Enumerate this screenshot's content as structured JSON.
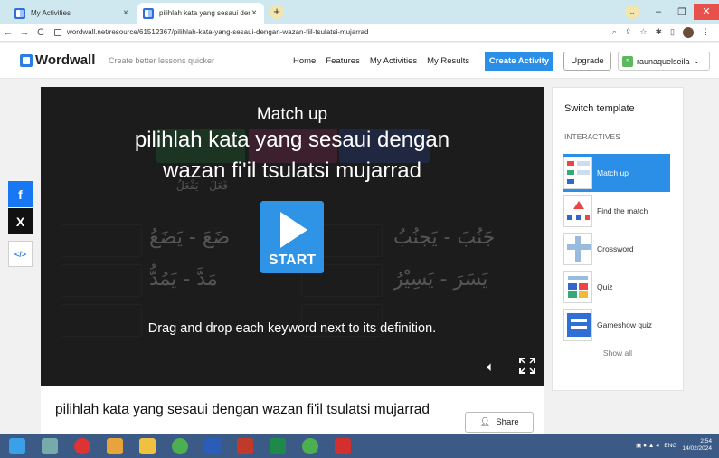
{
  "browser": {
    "tabs": [
      {
        "title": "My Activities"
      },
      {
        "title": "pilihlah kata yang sesaui dengan"
      }
    ],
    "url": "wordwall.net/resource/61512367/pilihlah-kata-yang-sesaui-dengan-wazan-fiil-tsulatsi-mujarrad"
  },
  "header": {
    "logo": "Wordwall",
    "tagline": "Create better lessons quicker",
    "nav": [
      "Home",
      "Features",
      "My Activities",
      "My Results"
    ],
    "create_label": "Create Activity",
    "upgrade_label": "Upgrade",
    "user_initial": "s",
    "username": "raunaquelseila"
  },
  "player": {
    "subtitle": "Match up",
    "title_line1": "pilihlah kata yang sesaui dengan",
    "title_line2": "wazan fi'il tsulatsi mujarrad",
    "start_label": "START",
    "instructions": "Drag and drop each keyword next to its definition.",
    "ghost_arabic": [
      "ضَعَ - يَضَعُ",
      "جَنُبَ - يَجنُبُ",
      "مَدَّ - يَمُدُّ",
      "يَسَرَ - يَسِيْرُ",
      "فَعَلَ - يَفْعَلُ"
    ]
  },
  "activity": {
    "title": "pilihlah kata yang sesaui dengan wazan fi'il tsulatsi mujarrad",
    "share_label": "Share"
  },
  "social": {
    "facebook": "f",
    "x": "X",
    "embed": "</>"
  },
  "switch_template": {
    "title": "Switch template",
    "section": "INTERACTIVES",
    "items": [
      "Match up",
      "Find the match",
      "Crossword",
      "Quiz",
      "Gameshow quiz"
    ],
    "show_all": "Show all"
  },
  "taskbar": {
    "lang": "ENG",
    "time": "2:54",
    "date": "14/02/2024"
  },
  "colors": {
    "accent": "#2b8fe7",
    "player_bg": "#1c1c1c",
    "taskbar": "#3c5a86"
  }
}
